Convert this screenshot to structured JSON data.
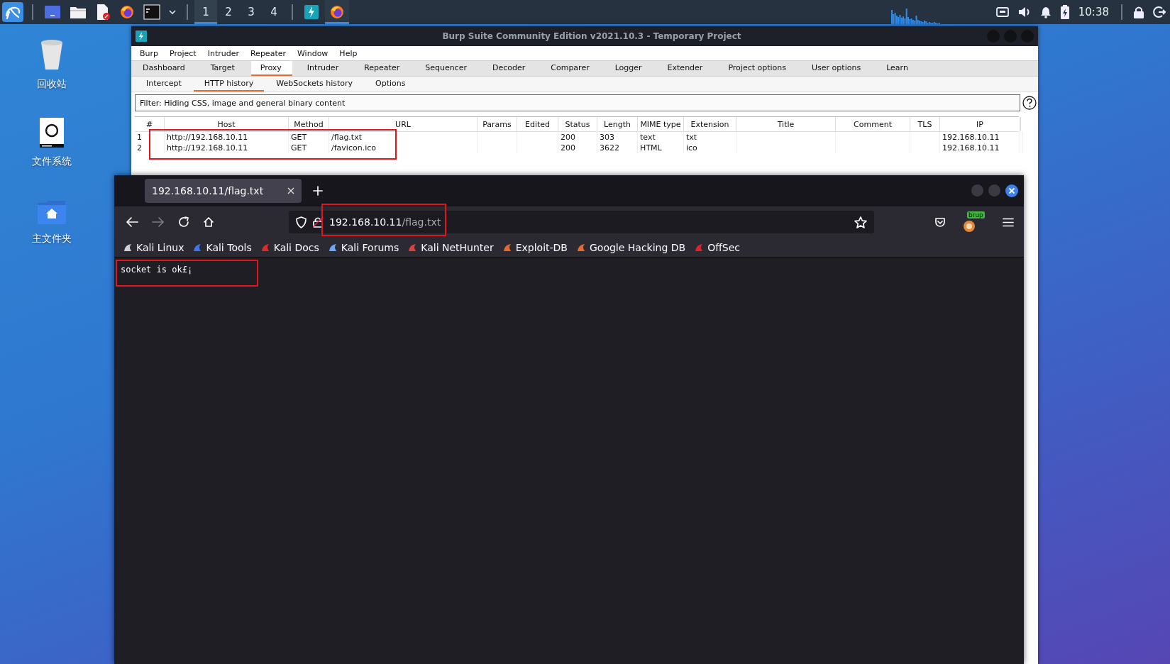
{
  "taskbar": {
    "apps": [
      {
        "kind": "terminal-menu"
      }
    ],
    "workspaces": [
      {
        "label": "1",
        "selected": true
      },
      {
        "label": "2",
        "selected": false
      },
      {
        "label": "3",
        "selected": false
      },
      {
        "label": "4",
        "selected": false
      }
    ],
    "windows": [
      {
        "kind": "burp",
        "selected": false
      },
      {
        "kind": "firefox",
        "selected": true
      }
    ],
    "clock": "10:38"
  },
  "desktop_icons": [
    {
      "label": "回收站",
      "kind": "trash"
    },
    {
      "label": "文件系统",
      "kind": "drive"
    },
    {
      "label": "主文件夹",
      "kind": "home"
    }
  ],
  "burp": {
    "title": "Burp Suite Community Edition v2021.10.3 - Temporary Project",
    "menu": [
      "Burp",
      "Project",
      "Intruder",
      "Repeater",
      "Window",
      "Help"
    ],
    "tabs": [
      {
        "label": "Dashboard",
        "selected": false
      },
      {
        "label": "Target",
        "selected": false
      },
      {
        "label": "Proxy",
        "selected": true
      },
      {
        "label": "Intruder",
        "selected": false
      },
      {
        "label": "Repeater",
        "selected": false
      },
      {
        "label": "Sequencer",
        "selected": false
      },
      {
        "label": "Decoder",
        "selected": false
      },
      {
        "label": "Comparer",
        "selected": false
      },
      {
        "label": "Logger",
        "selected": false
      },
      {
        "label": "Extender",
        "selected": false
      },
      {
        "label": "Project options",
        "selected": false
      },
      {
        "label": "User options",
        "selected": false
      },
      {
        "label": "Learn",
        "selected": false
      }
    ],
    "subtabs": [
      {
        "label": "Intercept",
        "selected": false
      },
      {
        "label": "HTTP history",
        "selected": true
      },
      {
        "label": "WebSockets history",
        "selected": false
      },
      {
        "label": "Options",
        "selected": false
      }
    ],
    "filter": "Filter: Hiding CSS, image and general binary content",
    "table": {
      "columns": [
        "#",
        "Host",
        "Method",
        "URL",
        "Params",
        "Edited",
        "Status",
        "Length",
        "MIME type",
        "Extension",
        "Title",
        "Comment",
        "TLS",
        "IP"
      ],
      "rows": [
        [
          "1",
          "http://192.168.10.11",
          "GET",
          "/flag.txt",
          null,
          null,
          "200",
          "303",
          "text",
          "txt",
          null,
          null,
          null,
          "192.168.10.11"
        ],
        [
          "2",
          "http://192.168.10.11",
          "GET",
          "/favicon.ico",
          null,
          null,
          "200",
          "3622",
          "HTML",
          "ico",
          null,
          null,
          null,
          "192.168.10.11"
        ]
      ]
    }
  },
  "browser": {
    "tab": {
      "title": "192.168.10.11/flag.txt"
    },
    "url_host": "192.168.10.11",
    "url_path": "/flag.txt",
    "extension_badge": "brup",
    "bookmarks": [
      "Kali Linux",
      "Kali Tools",
      "Kali Docs",
      "Kali Forums",
      "Kali NetHunter",
      "Exploit-DB",
      "Google Hacking DB",
      "OffSec"
    ],
    "content": "socket is ok£¡"
  }
}
